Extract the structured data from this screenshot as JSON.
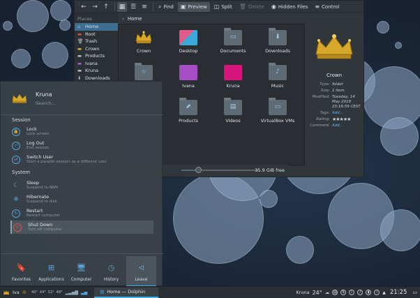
{
  "dolphin": {
    "toolbar": {
      "back_icon": "back-arrow-icon",
      "forward_icon": "forward-arrow-icon",
      "up_icon": "up-arrow-icon",
      "find": "Find",
      "preview": "Preview",
      "split": "Split",
      "delete": "Delete",
      "hidden_files": "Hidden Files",
      "control": "Control"
    },
    "places_title": "Places",
    "places": [
      {
        "label": "Home",
        "icon": "home-icon",
        "glyph": "⌂"
      },
      {
        "label": "Root",
        "icon": "folder-red-icon",
        "glyph": "▬"
      },
      {
        "label": "Trash",
        "icon": "trash-icon",
        "glyph": "🗑"
      },
      {
        "label": "Crown",
        "icon": "folder-icon",
        "glyph": "▬"
      },
      {
        "label": "Products",
        "icon": "folder-icon",
        "glyph": "▬"
      },
      {
        "label": "Ivana",
        "icon": "folder-purple-icon",
        "glyph": "▬"
      },
      {
        "label": "Kruna",
        "icon": "folder-icon",
        "glyph": "▬"
      },
      {
        "label": "Downloads",
        "icon": "download-icon",
        "glyph": "⬇"
      }
    ],
    "breadcrumb": "Home",
    "files": [
      {
        "label": "Crown",
        "kind": "crown-image"
      },
      {
        "label": "Desktop",
        "kind": "desktop-folder"
      },
      {
        "label": "Documents",
        "kind": "folder"
      },
      {
        "label": "Downloads",
        "kind": "folder"
      },
      {
        "label": "",
        "kind": "folder"
      },
      {
        "label": "Ivana",
        "kind": "folder-purple"
      },
      {
        "label": "Kruna",
        "kind": "folder-magenta"
      },
      {
        "label": "Music",
        "kind": "folder"
      },
      {
        "label": "Products",
        "kind": "folder"
      },
      {
        "label": "Videos",
        "kind": "folder"
      },
      {
        "label": "VirtualBox VMs",
        "kind": "folder"
      }
    ],
    "info": {
      "title": "Crown",
      "type_label": "Type:",
      "type_value": "folder",
      "size_label": "Size:",
      "size_value": "1 item",
      "modified_label": "Modified:",
      "modified_value": "Tuesday, 14 May 2019 23:16:59 CEST",
      "tags_label": "Tags:",
      "tags_value": "Add...",
      "rating_label": "Rating:",
      "rating_value": "★★★★★",
      "comment_label": "Comment:",
      "comment_value": "Add..."
    },
    "free_space": "35.9 GiB free"
  },
  "launcher": {
    "user_name": "Kruna",
    "search_placeholder": "Search...",
    "session_title": "Session",
    "system_title": "System",
    "session_entries": [
      {
        "title": "Lock",
        "subtitle": "Lock screen",
        "icon": "lock-icon"
      },
      {
        "title": "Log Out",
        "subtitle": "End session",
        "icon": "logout-icon"
      },
      {
        "title": "Switch User",
        "subtitle": "Start a parallel session as a different user",
        "icon": "switch-user-icon"
      }
    ],
    "system_entries": [
      {
        "title": "Sleep",
        "subtitle": "Suspend to RAM",
        "icon": "sleep-icon"
      },
      {
        "title": "Hibernate",
        "subtitle": "Suspend to disk",
        "icon": "hibernate-icon"
      },
      {
        "title": "Restart",
        "subtitle": "Restart computer",
        "icon": "restart-icon"
      },
      {
        "title": "Shut Down",
        "subtitle": "Turn off computer",
        "icon": "shutdown-icon"
      }
    ],
    "tabs": [
      {
        "label": "Favorites",
        "icon": "bookmark-icon"
      },
      {
        "label": "Applications",
        "icon": "applications-grid-icon"
      },
      {
        "label": "Computer",
        "icon": "computer-icon"
      },
      {
        "label": "History",
        "icon": "history-icon"
      },
      {
        "label": "Leave",
        "icon": "leave-icon"
      }
    ]
  },
  "panel": {
    "user_short": "Iva",
    "temps": [
      "40°",
      "44°",
      "52°",
      "48°"
    ],
    "task_label": "Home — Dolphin",
    "tray_user": "Kruna",
    "weather": "24°",
    "clock": "21:25"
  }
}
